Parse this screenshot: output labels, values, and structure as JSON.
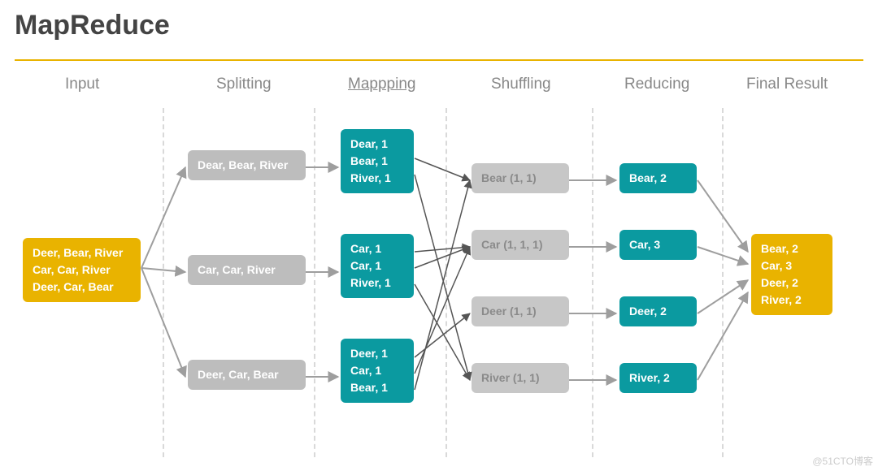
{
  "title": "MapReduce",
  "headers": {
    "input": "Input",
    "splitting": "Splitting",
    "mapping": "Mappping",
    "shuffling": "Shuffling",
    "reducing": "Reducing",
    "final": "Final Result"
  },
  "input_lines": [
    "Deer, Bear, River",
    "Car, Car, River",
    "Deer, Car, Bear"
  ],
  "split": [
    "Dear, Bear, River",
    "Car, Car, River",
    "Deer, Car, Bear"
  ],
  "map": [
    [
      "Dear, 1",
      "Bear, 1",
      "River, 1"
    ],
    [
      "Car, 1",
      "Car, 1",
      "River, 1"
    ],
    [
      "Deer, 1",
      "Car, 1",
      "Bear, 1"
    ]
  ],
  "shuffle": [
    "Bear (1, 1)",
    "Car (1, 1, 1)",
    "Deer (1, 1)",
    "River (1, 1)"
  ],
  "reduce": [
    "Bear, 2",
    "Car, 3",
    "Deer, 2",
    "River, 2"
  ],
  "final": [
    "Bear, 2",
    "Car, 3",
    "Deer, 2",
    "River, 2"
  ],
  "watermark": "@51CTO博客"
}
